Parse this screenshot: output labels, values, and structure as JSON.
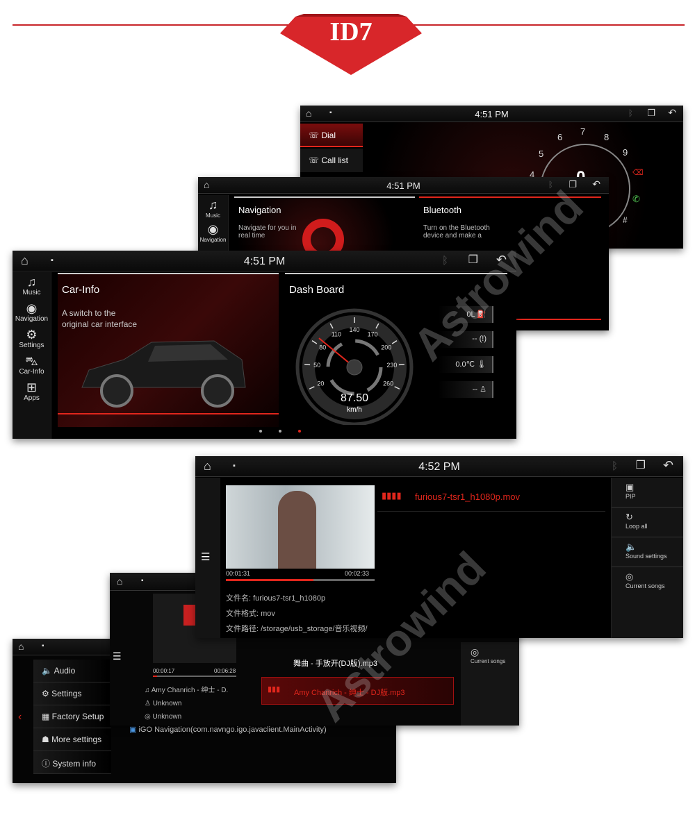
{
  "banner": {
    "label": "ID7",
    "accent": "#d8262a"
  },
  "watermark": "Astrowind",
  "phone": {
    "time": "4:51 PM",
    "menu": [
      "Dial",
      "Call list"
    ],
    "dial_digits": [
      "4",
      "5",
      "6",
      "7",
      "8",
      "9",
      "#"
    ],
    "display": "0"
  },
  "navbt": {
    "time": "4:51 PM",
    "sidebar": [
      "Music",
      "Navigation"
    ],
    "cards": [
      {
        "title": "Navigation",
        "desc": "Navigate for you in real time"
      },
      {
        "title": "Bluetooth",
        "desc": "Turn on the Bluetooth device and make a"
      }
    ]
  },
  "main": {
    "time": "4:51 PM",
    "sidebar": [
      {
        "label": "Music",
        "icon": "music-icon"
      },
      {
        "label": "Navigation",
        "icon": "navigation-icon"
      },
      {
        "label": "Settings",
        "icon": "gear-icon"
      },
      {
        "label": "Car-Info",
        "icon": "car-icon"
      },
      {
        "label": "Apps",
        "icon": "apps-icon"
      }
    ],
    "carinfo": {
      "title": "Car-Info",
      "desc1": "A switch to the",
      "desc2": "original car interface"
    },
    "dash": {
      "title": "Dash Board",
      "ticks": [
        "20",
        "50",
        "80",
        "110",
        "140",
        "170",
        "200",
        "230",
        "260"
      ],
      "speed": "87.50",
      "unit": "km/h",
      "speed_value": 87.5,
      "tiles": [
        {
          "value": "0L",
          "icon": "fuel-icon"
        },
        {
          "value": "--",
          "icon": "brake-warning-icon"
        },
        {
          "value": "0.0℃",
          "icon": "thermometer-icon"
        },
        {
          "value": "--",
          "icon": "seatbelt-icon"
        }
      ]
    },
    "page_dots": 3,
    "active_dot": 2
  },
  "video": {
    "time": "4:52 PM",
    "file": "furious7-tsr1_h1080p.mov",
    "elapsed": "00:01:31",
    "total": "00:02:33",
    "progress": 0.59,
    "info": [
      {
        "k": "文件名:",
        "v": "furious7-tsr1_h1080p"
      },
      {
        "k": "文件格式:",
        "v": "mov"
      },
      {
        "k": "文件路径:",
        "v": "/storage/usb_storage/音乐视频/"
      }
    ],
    "right": [
      "PIP",
      "Loop all",
      "Sound settings",
      "Current songs"
    ]
  },
  "music": {
    "elapsed": "00:00:17",
    "total": "00:06:28",
    "progress": 0.05,
    "track": "Amy Chanrich - 绅士 - D.",
    "artist": "Unknown",
    "album": "Unknown",
    "list": [
      "舞曲 - 手放开(DJ版).mp3",
      "Amy Chanrich - 绅士 - DJ版.mp3"
    ],
    "right": "Current songs"
  },
  "settings": {
    "menu": [
      "Audio",
      "Settings",
      "Factory Setup",
      "More settings",
      "System info"
    ],
    "app": "iGO Navigation(com.navngo.igo.javaclient.MainActivity)"
  }
}
